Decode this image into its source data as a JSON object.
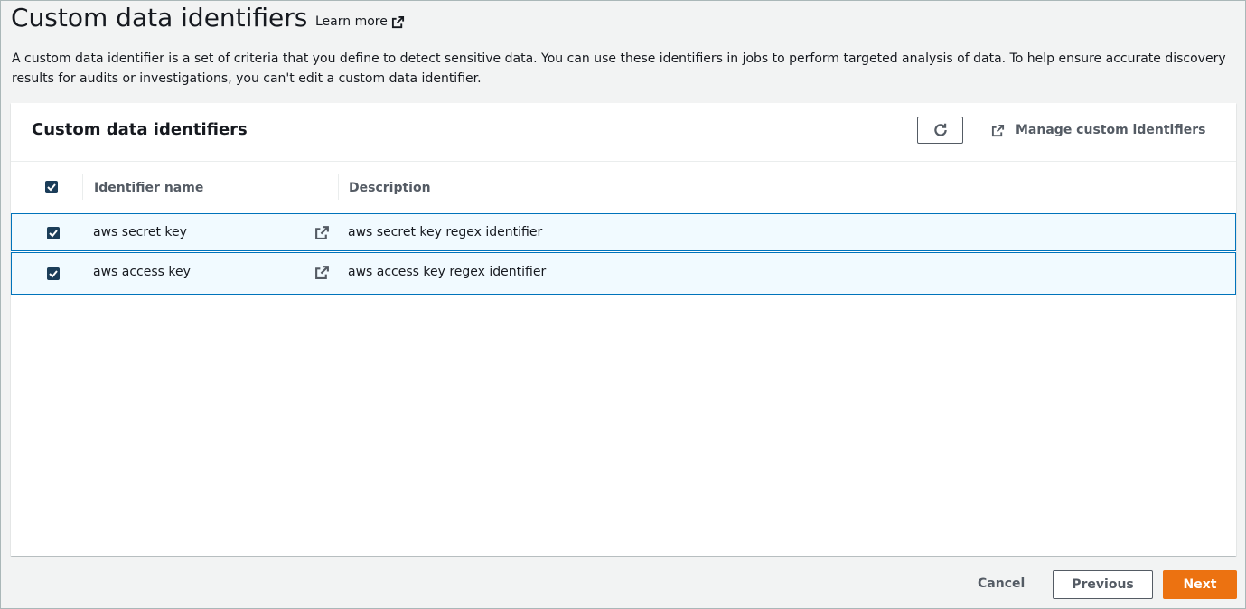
{
  "page": {
    "title": "Custom data identifiers",
    "learn_more": "Learn more",
    "description": "A custom data identifier is a set of criteria that you define to detect sensitive data. You can use these identifiers in jobs to perform targeted analysis of data. To help ensure accurate discovery results for audits or investigations, you can't edit a custom data identifier."
  },
  "panel": {
    "title": "Custom data identifiers",
    "refresh_icon": "refresh-icon",
    "manage_label": "Manage custom identifiers",
    "manage_icon": "external-link-icon"
  },
  "table": {
    "columns": [
      "Identifier name",
      "Description"
    ],
    "select_all_checked": true,
    "rows": [
      {
        "name": "aws secret key",
        "description": "aws secret key regex identifier",
        "checked": true
      },
      {
        "name": "aws access key",
        "description": "aws access key regex identifier",
        "checked": true
      }
    ]
  },
  "footer": {
    "cancel": "Cancel",
    "previous": "Previous",
    "next": "Next"
  },
  "colors": {
    "primary_button": "#ec7211",
    "selected_row_bg": "#f1faff",
    "selected_row_border": "#0073bb",
    "checkbox": "#1b3d59"
  }
}
